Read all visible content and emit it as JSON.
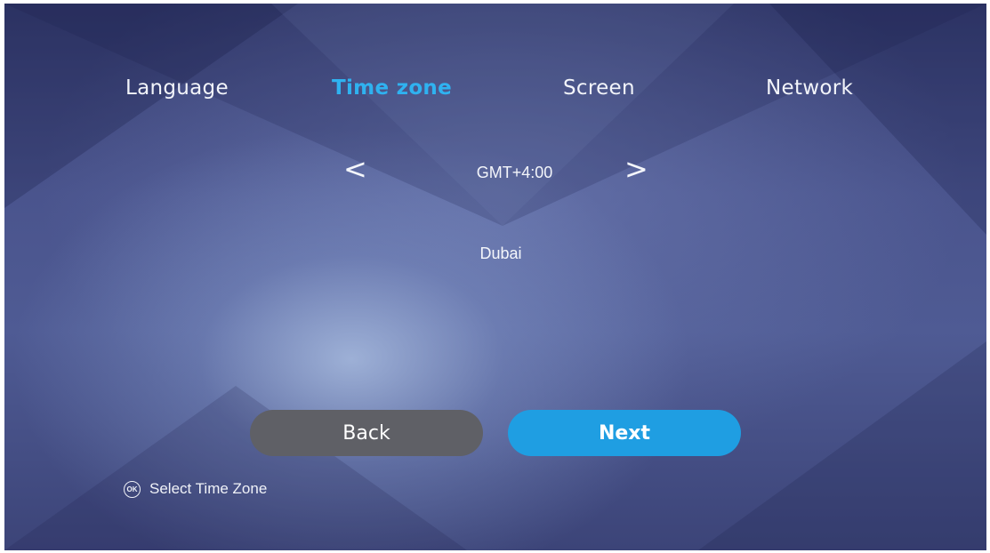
{
  "tabs": [
    {
      "label": "Language",
      "active": false
    },
    {
      "label": "Time zone",
      "active": true
    },
    {
      "label": "Screen",
      "active": false
    },
    {
      "label": "Network",
      "active": false
    }
  ],
  "timezone": {
    "prev_glyph": "<",
    "next_glyph": ">",
    "value": "GMT+4:00",
    "city": "Dubai"
  },
  "buttons": {
    "back_label": "Back",
    "next_label": "Next"
  },
  "hint": {
    "icon": "ok-button-icon",
    "icon_text": "OK",
    "text": "Select Time Zone"
  },
  "colors": {
    "accent": "#2fb2f0",
    "next_button": "#1f9ee2",
    "back_button": "#5f6066",
    "background": "#4a548d",
    "text": "#f2f4fa"
  }
}
